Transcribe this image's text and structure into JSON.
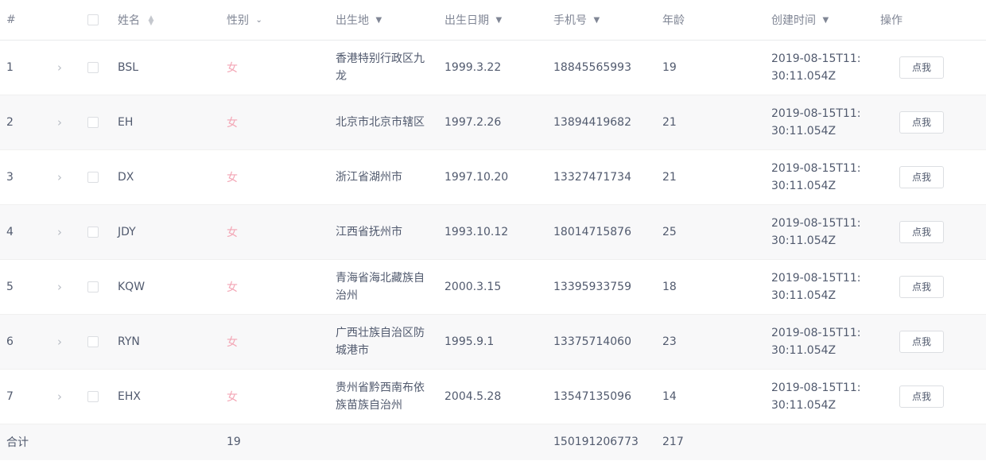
{
  "header": {
    "index": "#",
    "name": "姓名",
    "gender": "性别",
    "birthplace": "出生地",
    "birthdate": "出生日期",
    "phone": "手机号",
    "age": "年龄",
    "created": "创建时间",
    "action": "操作"
  },
  "rows": [
    {
      "index": "1",
      "name": "BSL",
      "gender": "女",
      "birthplace": "香港特别行政区九龙",
      "birthdate": "1999.3.22",
      "phone": "18845565993",
      "age": "19",
      "created": "2019-08-15T11:30:11.054Z",
      "action": "点我"
    },
    {
      "index": "2",
      "name": "EH",
      "gender": "女",
      "birthplace": "北京市北京市辖区",
      "birthdate": "1997.2.26",
      "phone": "13894419682",
      "age": "21",
      "created": "2019-08-15T11:30:11.054Z",
      "action": "点我"
    },
    {
      "index": "3",
      "name": "DX",
      "gender": "女",
      "birthplace": "浙江省湖州市",
      "birthdate": "1997.10.20",
      "phone": "13327471734",
      "age": "21",
      "created": "2019-08-15T11:30:11.054Z",
      "action": "点我"
    },
    {
      "index": "4",
      "name": "JDY",
      "gender": "女",
      "birthplace": "江西省抚州市",
      "birthdate": "1993.10.12",
      "phone": "18014715876",
      "age": "25",
      "created": "2019-08-15T11:30:11.054Z",
      "action": "点我"
    },
    {
      "index": "5",
      "name": "KQW",
      "gender": "女",
      "birthplace": "青海省海北藏族自治州",
      "birthdate": "2000.3.15",
      "phone": "13395933759",
      "age": "18",
      "created": "2019-08-15T11:30:11.054Z",
      "action": "点我"
    },
    {
      "index": "6",
      "name": "RYN",
      "gender": "女",
      "birthplace": "广西壮族自治区防城港市",
      "birthdate": "1995.9.1",
      "phone": "13375714060",
      "age": "23",
      "created": "2019-08-15T11:30:11.054Z",
      "action": "点我"
    },
    {
      "index": "7",
      "name": "EHX",
      "gender": "女",
      "birthplace": "贵州省黔西南布依族苗族自治州",
      "birthdate": "2004.5.28",
      "phone": "13547135096",
      "age": "14",
      "created": "2019-08-15T11:30:11.054Z",
      "action": "点我"
    }
  ],
  "footer": {
    "label": "合计",
    "gender_total": "19",
    "phone_total": "150191206773",
    "age_total": "217"
  },
  "icons": {
    "expand": "chevron-right-icon",
    "sort": "sort-icon",
    "filter": "caret-down-icon",
    "checkbox": "checkbox-icon"
  },
  "colors": {
    "gender_text": "#f3a6b5",
    "stripe": "#f8f8f9"
  }
}
